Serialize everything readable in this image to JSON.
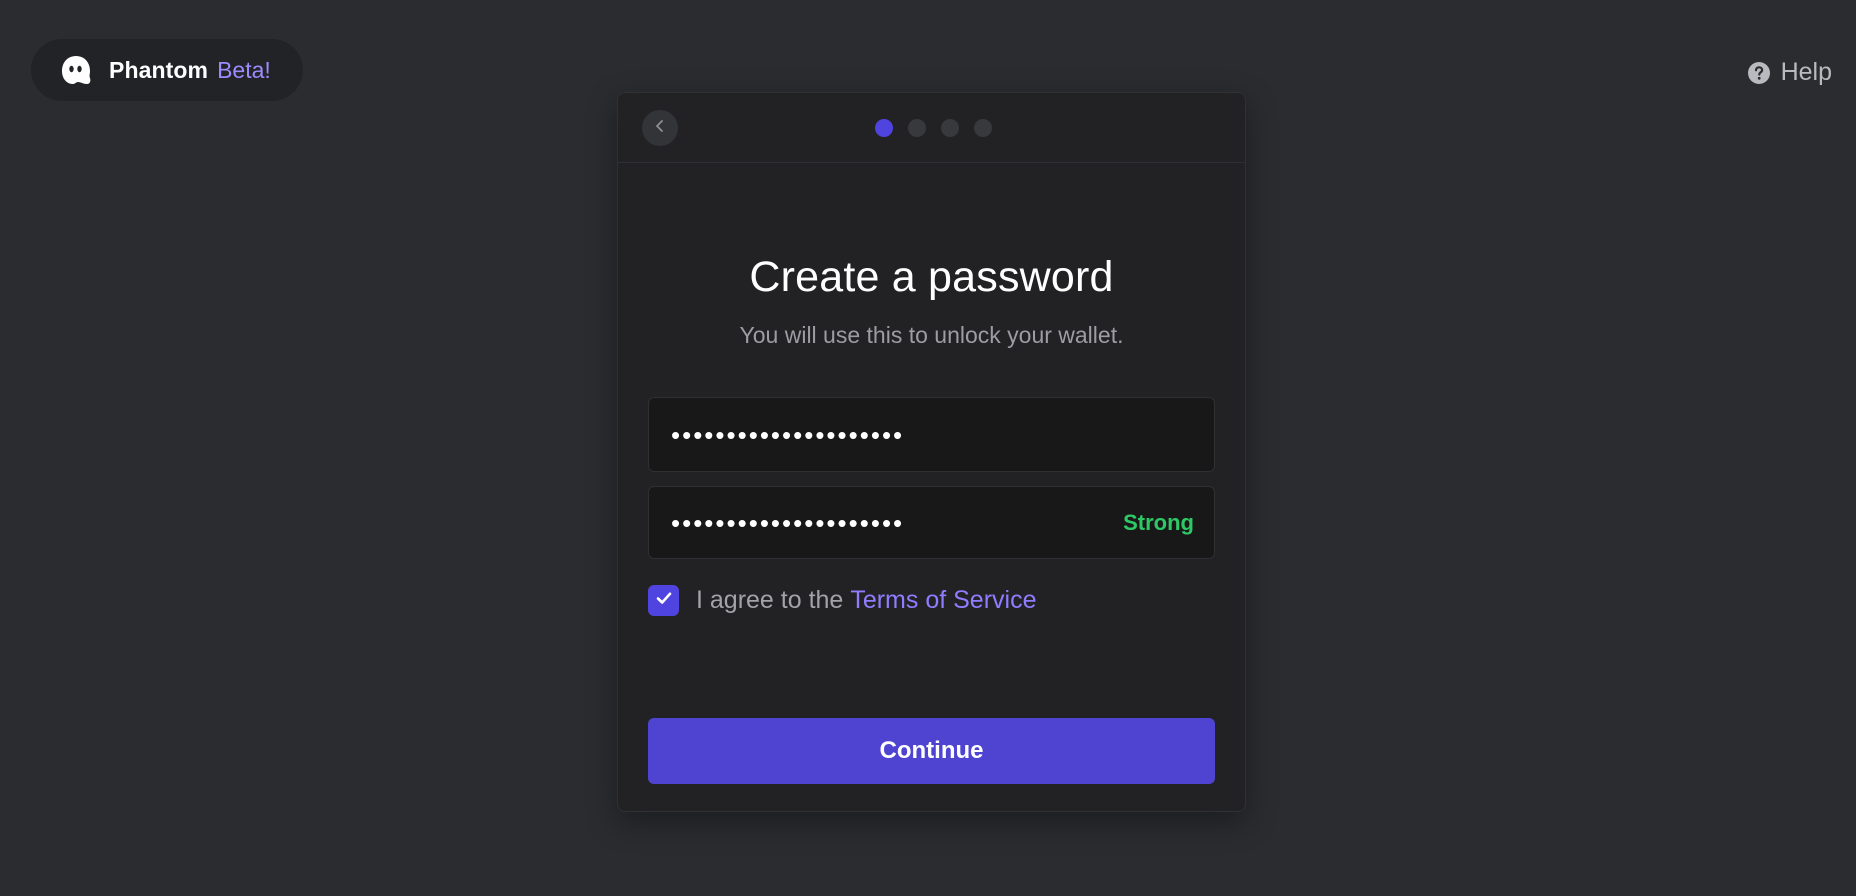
{
  "brand": {
    "name": "Phantom",
    "badge": "Beta!",
    "logo_icon": "phantom-ghost-icon"
  },
  "help": {
    "label": "Help",
    "icon": "question-circle-icon"
  },
  "stepper": {
    "total": 4,
    "current": 1
  },
  "card": {
    "back_icon": "chevron-left-icon",
    "title": "Create a password",
    "subtitle": "You will use this to unlock your wallet.",
    "password_value": "•••••••••••••••••••••",
    "confirm_value": "•••••••••••••••••••••",
    "strength_label": "Strong",
    "agree_checked": true,
    "agree_text": "I agree to the",
    "terms_link": "Terms of Service",
    "continue_label": "Continue"
  },
  "colors": {
    "background": "#2b2c30",
    "accent": "#4e44d1",
    "link": "#8f7cff",
    "strength_strong": "#2ec866"
  }
}
